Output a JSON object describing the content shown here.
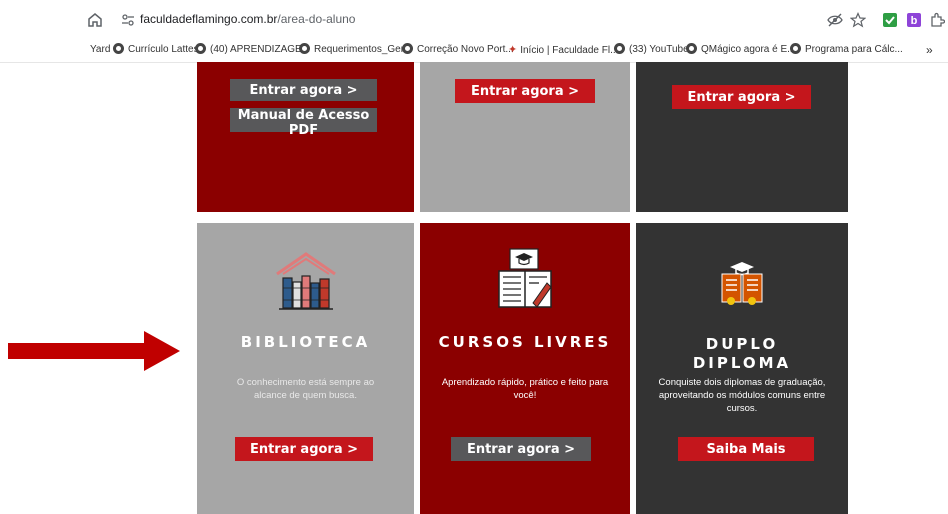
{
  "browser": {
    "url_domain": "faculdadeflamingo.com.br",
    "url_path": "/area-do-aluno",
    "bookmarks": [
      "Yard",
      "Currículo Lattes",
      "(40) APRENDIZAGE...",
      "Requerimentos_Ger...",
      "Correção Novo Port...",
      "Início | Faculdade Fl...",
      "(33) YouTube",
      "QMágico agora é E...",
      "Programa para Cálc..."
    ],
    "overflow": "»"
  },
  "top_row": {
    "tile1": {
      "enter_label": "Entrar agora >",
      "manual_label": "Manual de Acesso PDF"
    },
    "tile2": {
      "enter_label": "Entrar agora >"
    },
    "tile3": {
      "enter_label": "Entrar agora >"
    }
  },
  "cards": [
    {
      "title": "BIBLIOTECA",
      "description": "O conhecimento está sempre ao alcance de quem busca.",
      "button": "Entrar agora >"
    },
    {
      "title": "CURSOS LIVRES",
      "description": "Aprendizado rápido, prático e feito para você!",
      "button": "Entrar agora >"
    },
    {
      "title_line1": "DUPLO",
      "title_line2": "DIPLOMA",
      "description": "Conquiste dois diplomas de graduação, aproveitando os módulos comuns entre cursos.",
      "button": "Saiba Mais"
    }
  ],
  "colors": {
    "dark_red": "#8b0000",
    "gray": "#a6a6a6",
    "charcoal": "#333333",
    "button_red": "#c4161c",
    "button_gray": "#58585a",
    "arrow_red": "#c00000"
  }
}
